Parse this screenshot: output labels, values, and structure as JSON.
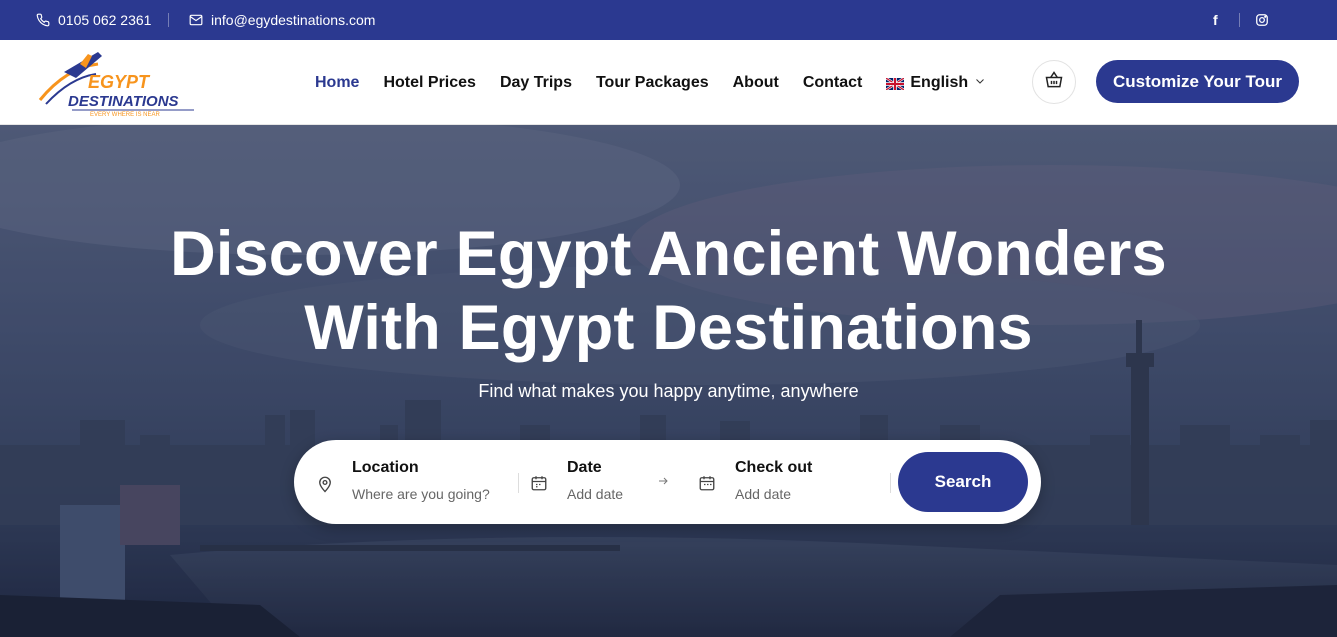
{
  "topbar": {
    "phone": "0105 062 2361",
    "email": "info@egydestinations.com",
    "social": [
      "facebook-icon",
      "instagram-icon"
    ]
  },
  "logo": {
    "line1": "EGYPT",
    "line2": "DESTINATIONS",
    "tagline": "EVERY WHERE IS NEAR"
  },
  "nav": {
    "items": [
      "Home",
      "Hotel Prices",
      "Day Trips",
      "Tour Packages",
      "About",
      "Contact"
    ],
    "active": "Home",
    "language": "English"
  },
  "header": {
    "cta": "Customize Your Tour"
  },
  "hero": {
    "title_line1": "Discover Egypt Ancient Wonders",
    "title_line2": "With Egypt Destinations",
    "subtitle": "Find what makes you happy anytime, anywhere"
  },
  "search": {
    "location_label": "Location",
    "location_placeholder": "Where are you going?",
    "date_label": "Date",
    "date_placeholder": "Add date",
    "checkout_label": "Check out",
    "checkout_placeholder": "Add date",
    "button": "Search"
  },
  "colors": {
    "brand": "#2b3990",
    "accent": "#f7941d"
  }
}
